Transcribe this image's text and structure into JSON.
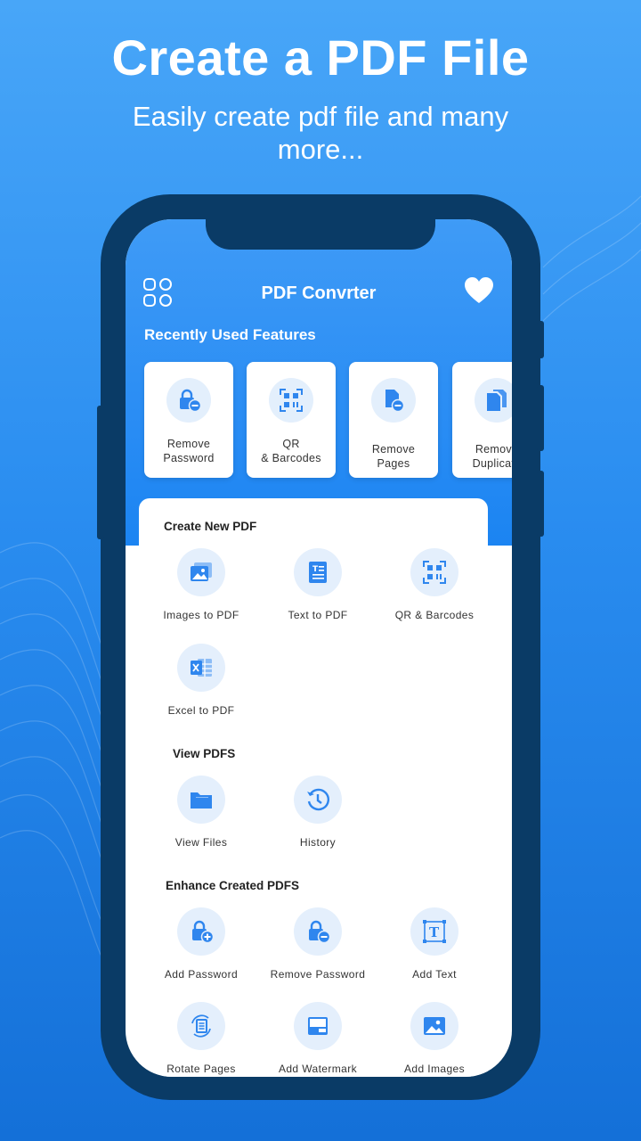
{
  "promo": {
    "headline": "Create a PDF File",
    "subline": "Easily create pdf file and many more..."
  },
  "app": {
    "title": "PDF Convrter",
    "recent_title": "Recently Used Features",
    "recent": [
      {
        "label": "Remove\nPassword",
        "icon": "lock-minus-icon"
      },
      {
        "label": "QR\n& Barcodes",
        "icon": "qr-code-icon"
      },
      {
        "label": "Remove\nPages",
        "icon": "page-minus-icon"
      },
      {
        "label": "Remove\nDuplicate",
        "icon": "duplicate-pages-icon"
      }
    ],
    "sections": {
      "create_title": "Create New PDF",
      "create_items": [
        {
          "label": "Images to PDF",
          "icon": "images-icon"
        },
        {
          "label": "Text to PDF",
          "icon": "text-document-icon"
        },
        {
          "label": "QR & Barcodes",
          "icon": "qr-code-icon"
        },
        {
          "label": "Excel to PDF",
          "icon": "excel-icon"
        }
      ],
      "view_title": "View PDFS",
      "view_items": [
        {
          "label": "View Files",
          "icon": "folder-icon"
        },
        {
          "label": "History",
          "icon": "history-clock-icon"
        }
      ],
      "enhance_title": "Enhance Created PDFS",
      "enhance_items": [
        {
          "label": "Add Password",
          "icon": "lock-plus-icon"
        },
        {
          "label": "Remove Password",
          "icon": "lock-minus-icon"
        },
        {
          "label": "Add Text",
          "icon": "text-frame-icon"
        },
        {
          "label": "Rotate Pages",
          "icon": "rotate-page-icon"
        },
        {
          "label": "Add Watermark",
          "icon": "watermark-icon"
        },
        {
          "label": "Add Images",
          "icon": "image-icon"
        }
      ]
    }
  },
  "colors": {
    "accent": "#2a8df4",
    "icon_blue": "#2f86ee",
    "phone_frame": "#0a3b66",
    "icon_bg": "#e4effc"
  }
}
